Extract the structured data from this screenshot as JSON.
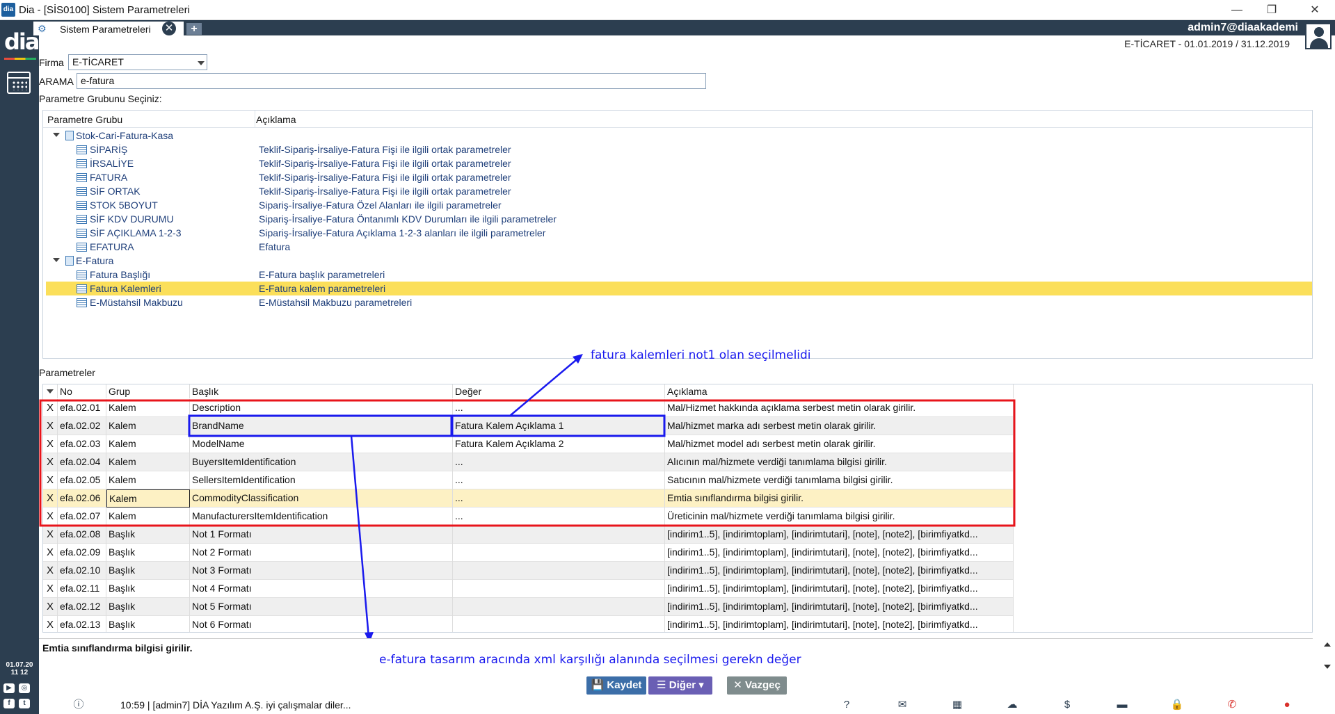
{
  "window": {
    "title": "Dia - [SİS0100] Sistem Parametreleri",
    "logo_text": "dia",
    "controls": {
      "minimize": "—",
      "maximize": "❐",
      "close": "✕"
    }
  },
  "sidebar": {
    "logo": "dia",
    "date_line1": "01.07.20",
    "date_line2": "11 12"
  },
  "tabs": {
    "active_label": "Sistem Parametreleri",
    "close_glyph": "✕",
    "add_glyph": "+"
  },
  "user": {
    "name": "admin7@diaakademi",
    "period": "E-TİCARET -  01.01.2019 / 31.12.2019"
  },
  "form": {
    "firma_label": "Firma",
    "firma_value": "E-TİCARET",
    "arama_label": "ARAMA",
    "arama_value": "e-fatura",
    "group_prompt": "Parametre Grubunu Seçiniz:"
  },
  "tree": {
    "headers": {
      "group": "Parametre Grubu",
      "desc": "Açıklama"
    },
    "rows": [
      {
        "name": "Stok-Cari-Fatura-Kasa",
        "desc": ""
      },
      {
        "name": "SİPARİŞ",
        "desc": "Teklif-Sipariş-İrsaliye-Fatura Fişi ile ilgili ortak parametreler"
      },
      {
        "name": "İRSALİYE",
        "desc": "Teklif-Sipariş-İrsaliye-Fatura Fişi ile ilgili ortak parametreler"
      },
      {
        "name": "FATURA",
        "desc": "Teklif-Sipariş-İrsaliye-Fatura Fişi ile ilgili ortak parametreler"
      },
      {
        "name": "SİF ORTAK",
        "desc": "Teklif-Sipariş-İrsaliye-Fatura Fişi ile ilgili ortak parametreler"
      },
      {
        "name": "STOK 5BOYUT",
        "desc": "Sipariş-İrsaliye-Fatura Özel Alanları ile ilgili parametreler"
      },
      {
        "name": "SİF KDV DURUMU",
        "desc": "Sipariş-İrsaliye-Fatura Öntanımlı KDV Durumları ile ilgili parametreler"
      },
      {
        "name": "SİF AÇIKLAMA 1-2-3",
        "desc": "Sipariş-İrsaliye-Fatura Açıklama 1-2-3 alanları ile ilgili parametreler"
      },
      {
        "name": "EFATURA",
        "desc": "Efatura"
      },
      {
        "name": "E-Fatura",
        "desc": ""
      },
      {
        "name": "Fatura Başlığı",
        "desc": "E-Fatura başlık parametreleri"
      },
      {
        "name": "Fatura Kalemleri",
        "desc": "E-Fatura kalem parametreleri"
      },
      {
        "name": "E-Müstahsil Makbuzu",
        "desc": "E-Müstahsil Makbuzu parametreleri"
      }
    ]
  },
  "grid": {
    "section_label": "Parametreler",
    "headers": {
      "no": "No",
      "grup": "Grup",
      "baslik": "Başlık",
      "deger": "Değer",
      "aciklama": "Açıklama"
    },
    "rows": [
      {
        "x": "X",
        "no": "efa.02.01",
        "grup": "Kalem",
        "baslik": "Description",
        "deger": "...",
        "aciklama": "Mal/Hizmet hakkında açıklama serbest metin olarak girilir."
      },
      {
        "x": "X",
        "no": "efa.02.02",
        "grup": "Kalem",
        "baslik": "BrandName",
        "deger": "Fatura Kalem Açıklama 1",
        "aciklama": "Mal/hizmet marka adı serbest metin olarak girilir."
      },
      {
        "x": "X",
        "no": "efa.02.03",
        "grup": "Kalem",
        "baslik": "ModelName",
        "deger": "Fatura Kalem Açıklama 2",
        "aciklama": "Mal/hizmet model adı serbest metin olarak girilir."
      },
      {
        "x": "X",
        "no": "efa.02.04",
        "grup": "Kalem",
        "baslik": "BuyersItemIdentification",
        "deger": "...",
        "aciklama": "Alıcının mal/hizmete verdiği tanımlama bilgisi girilir."
      },
      {
        "x": "X",
        "no": "efa.02.05",
        "grup": "Kalem",
        "baslik": "SellersItemIdentification",
        "deger": "...",
        "aciklama": "Satıcının mal/hizmete verdiği tanımlama bilgisi girilir."
      },
      {
        "x": "X",
        "no": "efa.02.06",
        "grup": "Kalem",
        "baslik": "CommodityClassification",
        "deger": "...",
        "aciklama": "Emtia sınıflandırma bilgisi girilir."
      },
      {
        "x": "X",
        "no": "efa.02.07",
        "grup": "Kalem",
        "baslik": "ManufacturersItemIdentification",
        "deger": "...",
        "aciklama": "Üreticinin mal/hizmete verdiği tanımlama bilgisi girilir."
      },
      {
        "x": "X",
        "no": "efa.02.08",
        "grup": "Başlık",
        "baslik": "Not 1 Formatı",
        "deger": "",
        "aciklama": "[indirim1..5], [indirimtoplam], [indirimtutari], [note], [note2], [birimfiyatkd..."
      },
      {
        "x": "X",
        "no": "efa.02.09",
        "grup": "Başlık",
        "baslik": "Not 2 Formatı",
        "deger": "",
        "aciklama": "[indirim1..5], [indirimtoplam], [indirimtutari], [note], [note2], [birimfiyatkd..."
      },
      {
        "x": "X",
        "no": "efa.02.10",
        "grup": "Başlık",
        "baslik": "Not 3 Formatı",
        "deger": "",
        "aciklama": "[indirim1..5], [indirimtoplam], [indirimtutari], [note], [note2], [birimfiyatkd..."
      },
      {
        "x": "X",
        "no": "efa.02.11",
        "grup": "Başlık",
        "baslik": "Not 4 Formatı",
        "deger": "",
        "aciklama": "[indirim1..5], [indirimtoplam], [indirimtutari], [note], [note2], [birimfiyatkd..."
      },
      {
        "x": "X",
        "no": "efa.02.12",
        "grup": "Başlık",
        "baslik": "Not 5 Formatı",
        "deger": "",
        "aciklama": "[indirim1..5], [indirimtoplam], [indirimtutari], [note], [note2], [birimfiyatkd..."
      },
      {
        "x": "X",
        "no": "efa.02.13",
        "grup": "Başlık",
        "baslik": "Not 6 Formatı",
        "deger": "",
        "aciklama": "[indirim1..5], [indirimtoplam], [indirimtutari], [note], [note2], [birimfiyatkd..."
      }
    ]
  },
  "annotations": {
    "top": "fatura kalemleri not1 olan seçilmelidi",
    "bottom": "e-fatura tasarım aracında xml karşılığı alanında seçilmesi gerekn değer",
    "red_color": "#e8141b",
    "blue_color": "#1a1aee"
  },
  "description_text": "Emtia sınıflandırma bilgisi girilir.",
  "buttons": {
    "save": "Kaydet",
    "other": "Diğer",
    "cancel": "Vazgeç"
  },
  "status": {
    "text": "10:59 | [admin7] DİA Yazılım A.Ş. iyi çalışmalar diler..."
  },
  "colors": {
    "sidebar": "#2c3e50",
    "selection": "#fbdf5a",
    "save_button": "#3c6ea8",
    "other_button": "#6a5fb4",
    "cancel_button": "#7f8c8d"
  }
}
